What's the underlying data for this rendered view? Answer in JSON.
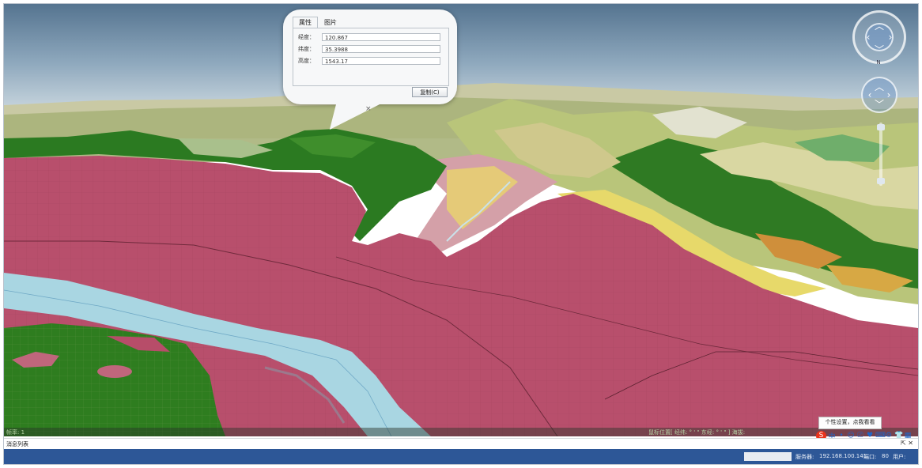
{
  "popup": {
    "tabs": [
      "属性",
      "图片"
    ],
    "rows": [
      {
        "label": "经度：",
        "value": "120.867"
      },
      {
        "label": "纬度：",
        "value": "35.3988"
      },
      {
        "label": "高度：",
        "value": "1543.17"
      }
    ],
    "copy_label": "复制(C)",
    "close_glyph": "×"
  },
  "navigation": {
    "north_label": "N",
    "icons": [
      "pan-compass-icon",
      "tilt-compass-icon",
      "zoom-slider"
    ]
  },
  "bottom_coords": {
    "left_text": "帧率: 1",
    "right_text": "鼠标位置[ 经纬: ° ' \" 东经: ° ' \" ] 海拔:"
  },
  "tooltip": {
    "text": "个性设置，点我看看"
  },
  "ime_bar": {
    "logo": "S",
    "items": [
      "中",
      "•",
      "☺",
      "⎚",
      "♥",
      "⌨",
      "⚙",
      "👕",
      "▦"
    ]
  },
  "message_list": {
    "title": "消息列表",
    "controls": "⇱ ✕"
  },
  "statusbar": {
    "server_label": "服务器:",
    "server_value": "192.168.100.141",
    "port_label": "端口:",
    "port_value": "80",
    "user_label": "用户:"
  },
  "colors": {
    "terrain_pink": "#b84f6c",
    "forest_green": "#2e7d1f",
    "river_blue": "#a9d6e2",
    "sky_top": "#5f7c98",
    "statusbar": "#2d5797"
  }
}
